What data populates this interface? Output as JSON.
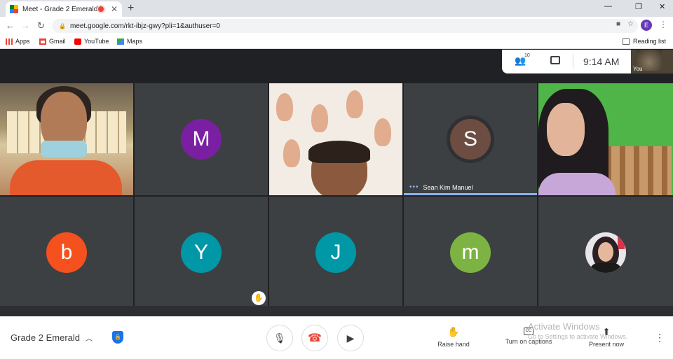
{
  "browser": {
    "tab_title": "Meet - Grade 2 Emerald",
    "tab_close": "✕",
    "new_tab": "+",
    "window_controls": {
      "minimize": "—",
      "maximize": "❐",
      "close": "✕"
    },
    "url": "meet.google.com/rkt-ibjz-gwy?pli=1&authuser=0",
    "profile_initial": "E",
    "bookmarks": [
      {
        "label": "Apps",
        "icon": "apps-grid-icon",
        "color": "#ea4335"
      },
      {
        "label": "Gmail",
        "icon": "gmail-icon",
        "color": "#ea4335"
      },
      {
        "label": "YouTube",
        "icon": "youtube-icon",
        "color": "#ff0000"
      },
      {
        "label": "Maps",
        "icon": "maps-icon",
        "color": "#34a853"
      }
    ],
    "reading_list": "Reading list"
  },
  "meet": {
    "participants_count": "10",
    "time": "9:14  AM",
    "self_label": "You",
    "tiles_top": [
      {
        "type": "video",
        "id": "teacher"
      },
      {
        "type": "initial",
        "letter": "M",
        "color": "#7b1fa2"
      },
      {
        "type": "video",
        "id": "child"
      },
      {
        "type": "initial",
        "letter": "S",
        "color": "#6d4c41",
        "name": "Sean Kim Manuel",
        "speaking": true
      },
      {
        "type": "video",
        "id": "girl"
      }
    ],
    "tiles_bottom": [
      {
        "type": "initial",
        "letter": "b",
        "color": "#f4511e"
      },
      {
        "type": "initial",
        "letter": "Y",
        "color": "#0097a7"
      },
      {
        "type": "initial",
        "letter": "J",
        "color": "#0097a7"
      },
      {
        "type": "initial",
        "letter": "m",
        "color": "#7cb342"
      },
      {
        "type": "photo"
      }
    ]
  },
  "bottom_bar": {
    "meeting_name": "Grade 2 Emerald",
    "raise_hand": "Raise hand",
    "captions": "Turn on captions",
    "captions_icon_text": "CC",
    "present": "Present now",
    "watermark_line1": "Activate Windows",
    "watermark_line2": "Go to Settings to activate Windows."
  },
  "colors": {
    "background": "#202124",
    "tile": "#3c4043",
    "accent_blue": "#1a73e8",
    "hangup_red": "#ea4335"
  }
}
